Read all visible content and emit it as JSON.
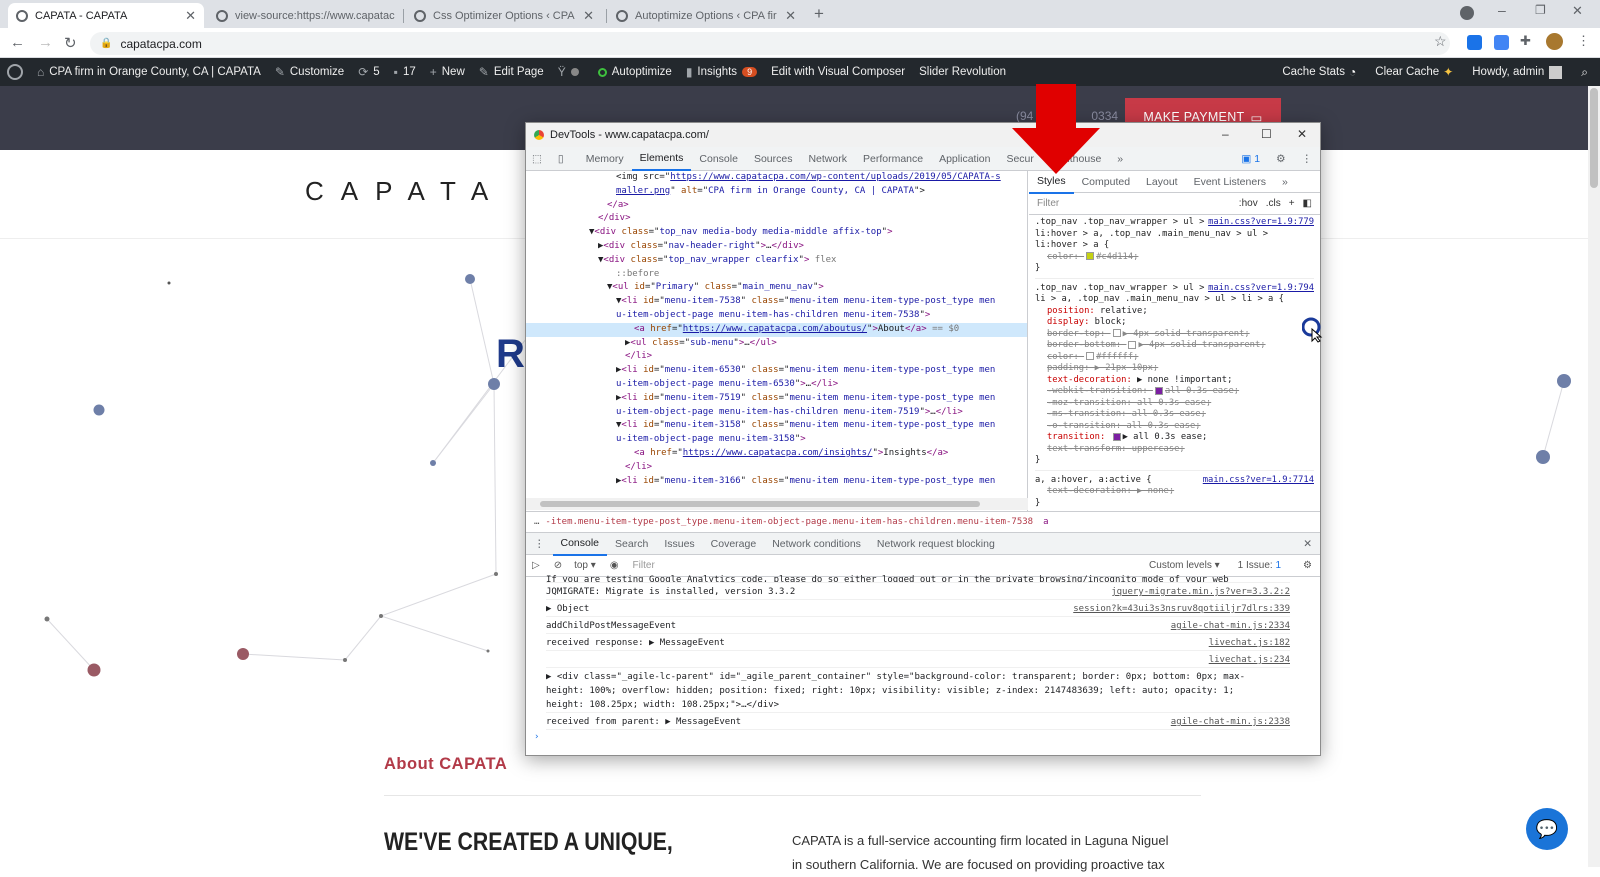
{
  "browser": {
    "tabs": [
      {
        "title": "CAPATA - CAPATA",
        "active": true
      },
      {
        "title": "view-source:https://www.capatac",
        "active": false
      },
      {
        "title": "Css Optimizer Options ‹ CPA firm",
        "active": false
      },
      {
        "title": "Autoptimize Options ‹ CPA firm",
        "active": false
      }
    ],
    "new_tab": "+",
    "url": "capatacpa.com"
  },
  "wp_bar": {
    "site": "CPA firm in Orange County, CA | CAPATA",
    "customize": "Customize",
    "updates": "5",
    "comments": "17",
    "new": "New",
    "edit_page": "Edit Page",
    "autoptimize": "Autoptimize",
    "insights": "Insights",
    "insights_badge": "9",
    "visual_composer": "Edit with Visual Composer",
    "slider": "Slider Revolution",
    "cache_stats": "Cache Stats",
    "clear_cache": "Clear Cache",
    "howdy": "Howdy, admin"
  },
  "site": {
    "phone": "(94",
    "phone_end": "0334",
    "pay_button": "MAKE PAYMENT",
    "logo": "CAPATA",
    "hero_letter": "R",
    "about_heading": "About CAPATA",
    "headline": "WE'VE CREATED A UNIQUE,",
    "body_line1": "CAPATA is a full-service accounting firm located in Laguna Niguel",
    "body_line2": "in southern California. We are focused on providing proactive tax"
  },
  "devtools": {
    "title": "DevTools - www.capatacpa.com/",
    "tabs": [
      "Memory",
      "Elements",
      "Console",
      "Sources",
      "Network",
      "Performance",
      "Application",
      "Secur",
      "Lighthouse"
    ],
    "issues_count": "1",
    "styles_tabs": [
      "Styles",
      "Computed",
      "Layout",
      "Event Listeners"
    ],
    "filter_placeholder": "Filter",
    "hov": ":hov",
    "cls": ".cls",
    "breadcrumb": "-item.menu-item-type-post_type.menu-item-object-page.menu-item-has-children.menu-item-7538",
    "crumb_end": "a",
    "drawer_tabs": [
      "Console",
      "Search",
      "Issues",
      "Coverage",
      "Network conditions",
      "Network request blocking"
    ],
    "console_context": "top",
    "console_filter": "Filter",
    "custom_levels": "Custom levels",
    "issue_label": "1 Issue:",
    "issue_count": "1"
  },
  "elements_lines": [
    {
      "indent": 10,
      "html": "&lt;img src=\"<span class='lk'>https://www.capatacpa.com/wp-content/uploads/2019/05/CAPATA-s</span>"
    },
    {
      "indent": 10,
      "html": "<span class='lk'>maller.png</span>\" <span class='at'>alt</span>=\"<span class='av'>CPA firm in Orange County, CA | CAPATA</span>\"&gt;"
    },
    {
      "indent": 9,
      "html": "<span class='tg'>&lt;/a&gt;</span>"
    },
    {
      "indent": 8,
      "html": "<span class='tg'>&lt;/div&gt;</span>"
    },
    {
      "indent": 7,
      "html": "▼<span class='tg'>&lt;div</span> <span class='at'>class</span>=\"<span class='av'>top_nav media-body media-middle affix-top</span>\"<span class='tg'>&gt;</span>"
    },
    {
      "indent": 8,
      "html": "▶<span class='tg'>&lt;div</span> <span class='at'>class</span>=\"<span class='av'>nav-header-right</span>\"<span class='tg'>&gt;</span>…<span class='tg'>&lt;/div&gt;</span>"
    },
    {
      "indent": 8,
      "html": "▼<span class='tg'>&lt;div</span> <span class='at'>class</span>=\"<span class='av'>top_nav_wrapper clearfix</span>\"<span class='tg'>&gt;</span> <span class='cm'>flex</span>"
    },
    {
      "indent": 10,
      "html": "<span class='cm'>::before</span>"
    },
    {
      "indent": 9,
      "html": "▼<span class='tg'>&lt;ul</span> <span class='at'>id</span>=\"<span class='av'>Primary</span>\" <span class='at'>class</span>=\"<span class='av'>main_menu_nav</span>\"<span class='tg'>&gt;</span>"
    },
    {
      "indent": 10,
      "html": "▼<span class='tg'>&lt;li</span> <span class='at'>id</span>=\"<span class='av'>menu-item-7538</span>\" <span class='at'>class</span>=\"<span class='av'>menu-item menu-item-type-post_type men</span>"
    },
    {
      "indent": 10,
      "html": "<span class='av'>u-item-object-page menu-item-has-children menu-item-7538</span>\"<span class='tg'>&gt;</span>"
    },
    {
      "indent": 12,
      "sel": true,
      "html": "<span class='tg'>&lt;a</span> <span class='at'>href</span>=\"<span class='lk'>https://www.capatacpa.com/aboutus/</span>\"<span class='tg'>&gt;</span>About<span class='tg'>&lt;/a&gt;</span> <span class='cm'>== $0</span>"
    },
    {
      "indent": 11,
      "html": "▶<span class='tg'>&lt;ul</span> <span class='at'>class</span>=\"<span class='av'>sub-menu</span>\"<span class='tg'>&gt;</span>…<span class='tg'>&lt;/ul&gt;</span>"
    },
    {
      "indent": 11,
      "html": "<span class='tg'>&lt;/li&gt;</span>"
    },
    {
      "indent": 10,
      "html": "▶<span class='tg'>&lt;li</span> <span class='at'>id</span>=\"<span class='av'>menu-item-6530</span>\" <span class='at'>class</span>=\"<span class='av'>menu-item menu-item-type-post_type men</span>"
    },
    {
      "indent": 10,
      "html": "<span class='av'>u-item-object-page menu-item-6530</span>\"<span class='tg'>&gt;</span>…<span class='tg'>&lt;/li&gt;</span>"
    },
    {
      "indent": 10,
      "html": "▶<span class='tg'>&lt;li</span> <span class='at'>id</span>=\"<span class='av'>menu-item-7519</span>\" <span class='at'>class</span>=\"<span class='av'>menu-item menu-item-type-post_type men</span>"
    },
    {
      "indent": 10,
      "html": "<span class='av'>u-item-object-page menu-item-has-children menu-item-7519</span>\"<span class='tg'>&gt;</span>…<span class='tg'>&lt;/li&gt;</span>"
    },
    {
      "indent": 10,
      "html": "▼<span class='tg'>&lt;li</span> <span class='at'>id</span>=\"<span class='av'>menu-item-3158</span>\" <span class='at'>class</span>=\"<span class='av'>menu-item menu-item-type-post_type men</span>"
    },
    {
      "indent": 10,
      "html": "<span class='av'>u-item-object-page menu-item-3158</span>\"<span class='tg'>&gt;</span>"
    },
    {
      "indent": 12,
      "html": "<span class='tg'>&lt;a</span> <span class='at'>href</span>=\"<span class='lk'>https://www.capatacpa.com/insights/</span>\"<span class='tg'>&gt;</span>Insights<span class='tg'>&lt;/a&gt;</span>"
    },
    {
      "indent": 11,
      "html": "<span class='tg'>&lt;/li&gt;</span>"
    },
    {
      "indent": 10,
      "html": "▶<span class='tg'>&lt;li</span> <span class='at'>id</span>=\"<span class='av'>menu-item-3166</span>\" <span class='at'>class</span>=\"<span class='av'>menu-item menu-item-type-post_type men</span>"
    }
  ],
  "style_rules": [
    {
      "selector": ".top_nav .top_nav_wrapper > ul > li:hover > a, .top_nav .main_menu_nav > ul > li:hover > a {",
      "source": "main.css?ver=1.9:779",
      "props": [
        {
          "name": "color",
          "value": "#c4d114",
          "swatch": "#c4d114",
          "struck": true
        }
      ]
    },
    {
      "selector": ".top_nav .top_nav_wrapper > ul > li > a, .top_nav .main_menu_nav > ul > li > a {",
      "source": "main.css?ver=1.9:794",
      "props": [
        {
          "name": "position",
          "value": "relative",
          "struck": false
        },
        {
          "name": "display",
          "value": "block",
          "struck": false
        },
        {
          "name": "border-top",
          "value": "▶ 4px solid transparent",
          "swatch": "transparent",
          "struck": true
        },
        {
          "name": "border-bottom",
          "value": "▶ 4px solid transparent",
          "swatch": "transparent",
          "struck": true
        },
        {
          "name": "color",
          "value": "#ffffff",
          "swatch": "#ffffff",
          "struck": true
        },
        {
          "name": "padding",
          "value": "▶ 21px 10px",
          "struck": true
        },
        {
          "name": "text-decoration",
          "value": "▶ none !important",
          "struck": false
        },
        {
          "name": "-webkit-transition",
          "value": "all 0.3s ease",
          "swatch": "#7b1fa2",
          "struck": true
        },
        {
          "name": "-moz-transition",
          "value": "all 0.3s ease",
          "struck": true
        },
        {
          "name": "-ms-transition",
          "value": "all 0.3s ease",
          "struck": true
        },
        {
          "name": "-o-transition",
          "value": "all 0.3s ease",
          "struck": true
        },
        {
          "name": "transition",
          "value": "▶ all 0.3s ease",
          "swatch": "#7b1fa2",
          "struck": false
        },
        {
          "name": "text-transform",
          "value": "uppercase",
          "struck": true
        }
      ]
    },
    {
      "selector": "a, a:hover, a:active {",
      "source": "main.css?ver=1.9:7714",
      "props": [
        {
          "name": "text-decoration",
          "value": "▶ none",
          "struck": true
        }
      ]
    }
  ],
  "console_lines": [
    {
      "text": "If you are testing Google Analytics code, please do so either logged out or in the private browsing/incognito mode of your web browser.",
      "ref": ""
    },
    {
      "text": "JQMIGRATE: Migrate is installed, version 3.3.2",
      "ref": "jquery-migrate.min.js?ver=3.3.2:2"
    },
    {
      "text": "▶ Object",
      "ref": "session?k=43ui3s3nsruv8qotiiljr7dlrs:339"
    },
    {
      "text": "addChildPostMessageEvent",
      "ref": "agile-chat-min.js:2334"
    },
    {
      "text": "received response:  ▶ MessageEvent",
      "ref": "livechat.js:182"
    },
    {
      "text": "",
      "ref": "livechat.js:234"
    },
    {
      "text": "▶ <div class=\"_agile-lc-parent\" id=\"_agile_parent_container\" style=\"background-color: transparent; border: 0px; bottom: 0px; max-height: 100%; overflow: hidden; position: fixed; right: 10px; visibility: visible; z-index: 2147483639; left: auto; opacity: 1; height: 108.25px; width: 108.25px;\">…</div>",
      "ref": ""
    },
    {
      "text": "received from parent:  ▶ MessageEvent",
      "ref": "agile-chat-min.js:2338"
    }
  ],
  "colors": {
    "accent": "#1a73e8",
    "brand_red": "#c73a47",
    "wp_bar": "#23282d",
    "site_header": "#3b3d4a",
    "arrow": "#e00000"
  }
}
